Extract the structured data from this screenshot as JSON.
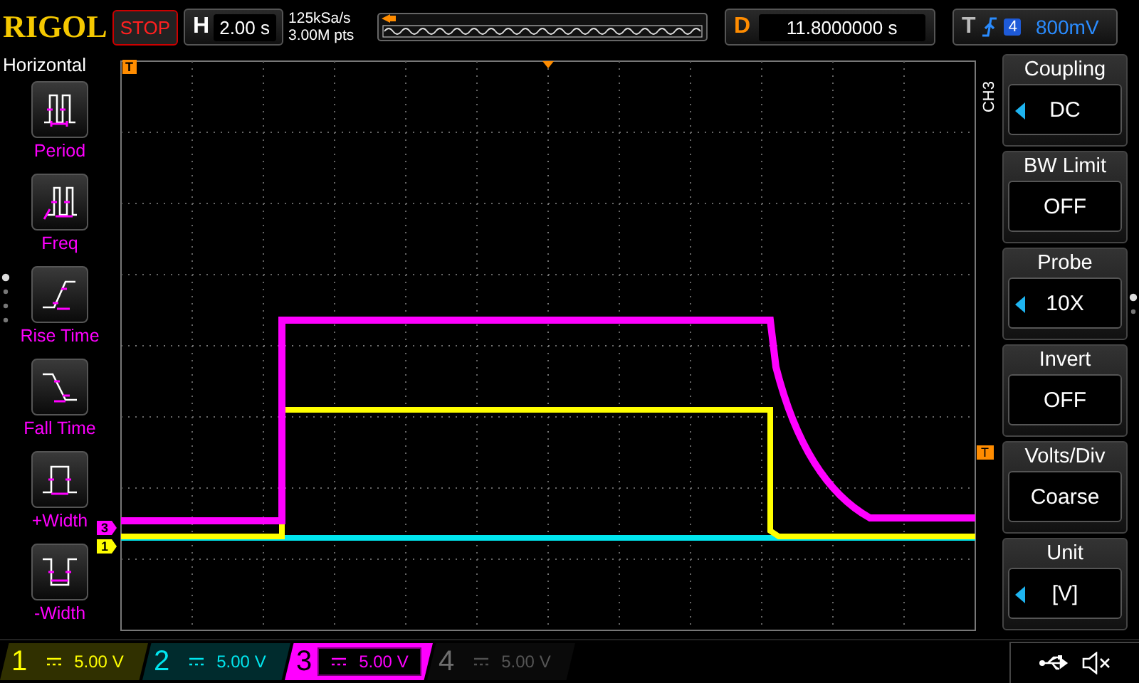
{
  "brand": "RIGOL",
  "run_state": "STOP",
  "horizontal": {
    "label": "H",
    "value": "2.00 s"
  },
  "acquisition": {
    "sample_rate": "125kSa/s",
    "memory_depth": "3.00M pts"
  },
  "delay": {
    "label": "D",
    "value": "11.8000000 s"
  },
  "trigger": {
    "label": "T",
    "source": "4",
    "level": "800mV"
  },
  "left_menu": {
    "title": "Horizontal",
    "items": [
      {
        "label": "Period",
        "kind": "period"
      },
      {
        "label": "Freq",
        "kind": "freq"
      },
      {
        "label": "Rise Time",
        "kind": "rise"
      },
      {
        "label": "Fall Time",
        "kind": "fall"
      },
      {
        "label": "+Width",
        "kind": "pwidth"
      },
      {
        "label": "-Width",
        "kind": "nwidth"
      }
    ]
  },
  "right_menu": {
    "channel": "CH3",
    "items": [
      {
        "title": "Coupling",
        "value": "DC",
        "adjustable": true
      },
      {
        "title": "BW Limit",
        "value": "OFF",
        "adjustable": false
      },
      {
        "title": "Probe",
        "value": "10X",
        "adjustable": true
      },
      {
        "title": "Invert",
        "value": "OFF",
        "adjustable": false
      },
      {
        "title": "Volts/Div",
        "value": "Coarse",
        "adjustable": false
      },
      {
        "title": "Unit",
        "value": "[V]",
        "adjustable": true
      }
    ]
  },
  "screen_markers": {
    "trigger_position": "T",
    "trigger_level": "T",
    "channels": [
      {
        "label": "3",
        "color": "#ff00ff"
      },
      {
        "label": "1",
        "color": "#ffff00"
      }
    ]
  },
  "channels": [
    {
      "number": "1",
      "scale": "5.00 V",
      "color": "#ffff00",
      "on": true,
      "selected": false
    },
    {
      "number": "2",
      "scale": "5.00 V",
      "color": "#00e5ee",
      "on": true,
      "selected": false
    },
    {
      "number": "3",
      "scale": "5.00 V",
      "color": "#ff00ff",
      "on": true,
      "selected": true
    },
    {
      "number": "4",
      "scale": "5.00 V",
      "color": "#6e6e6e",
      "on": false,
      "selected": false
    }
  ]
}
